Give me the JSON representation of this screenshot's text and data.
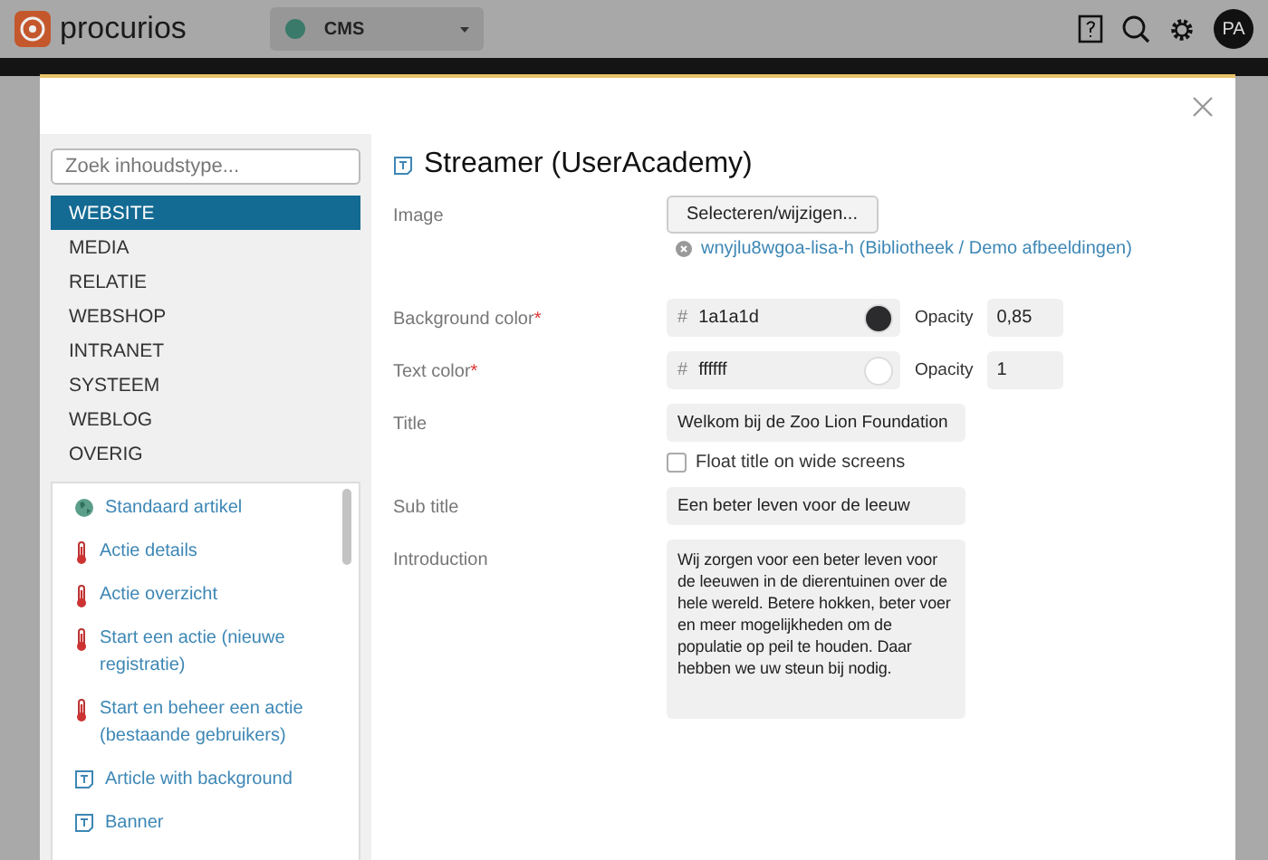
{
  "app": {
    "logo": "procurios",
    "site_select": "CMS",
    "avatar": "PA"
  },
  "dialog": {
    "search": {
      "placeholder": "Zoek inhoudstype..."
    },
    "categories": [
      {
        "label": "WEBSITE",
        "selected": true
      },
      {
        "label": "MEDIA",
        "selected": false
      },
      {
        "label": "RELATIE",
        "selected": false
      },
      {
        "label": "WEBSHOP",
        "selected": false
      },
      {
        "label": "INTRANET",
        "selected": false
      },
      {
        "label": "SYSTEEM",
        "selected": false
      },
      {
        "label": "WEBLOG",
        "selected": false
      },
      {
        "label": "OVERIG",
        "selected": false
      }
    ],
    "content_types": [
      {
        "kind": "globe",
        "label": "Standaard artikel"
      },
      {
        "kind": "thermometer",
        "label": "Actie details"
      },
      {
        "kind": "thermometer",
        "label": "Actie overzicht"
      },
      {
        "kind": "thermometer",
        "label": "Start een actie (nieuwe registratie)"
      },
      {
        "kind": "thermometer",
        "label": "Start en beheer een actie (bestaande gebruikers)"
      },
      {
        "kind": "text-block",
        "label": "Article with background"
      },
      {
        "kind": "text-block",
        "label": "Banner"
      }
    ],
    "title": "Streamer (UserAcademy)",
    "fields": [
      {
        "kind": "image",
        "label": "Image",
        "button": "Selecteren/wijzigen...",
        "file": "wnyjlu8wgoa-lisa-h (Bibliotheek / Demo afbeeldingen)"
      },
      {
        "kind": "color",
        "label": "Background color",
        "required_mark": "*",
        "prefix": "#",
        "value": "1a1a1d",
        "color": "#2b2b2d",
        "opacity_label": "Opacity",
        "opacity": "0,85"
      },
      {
        "kind": "color",
        "label": "Text color",
        "required_mark": "*",
        "prefix": "#",
        "value": "ffffff",
        "color": "#ffffff",
        "opacity_label": "Opacity",
        "opacity": "1"
      },
      {
        "kind": "text",
        "label": "Title",
        "value": "Welkom bij de Zoo Lion Foundation"
      },
      {
        "kind": "checkbox",
        "label": "Float title on wide screens",
        "checked": false
      },
      {
        "kind": "text",
        "label": "Sub title",
        "value": "Een beter leven voor de leeuw"
      },
      {
        "kind": "textarea",
        "label": "Introduction",
        "value": "Wij zorgen voor een beter leven voor de leeuwen in de dierentuinen over de hele wereld. Betere hokken, beter voer en meer mogelijkheden om de populatie op peil te houden. Daar hebben we uw steun bij nodig."
      }
    ]
  }
}
